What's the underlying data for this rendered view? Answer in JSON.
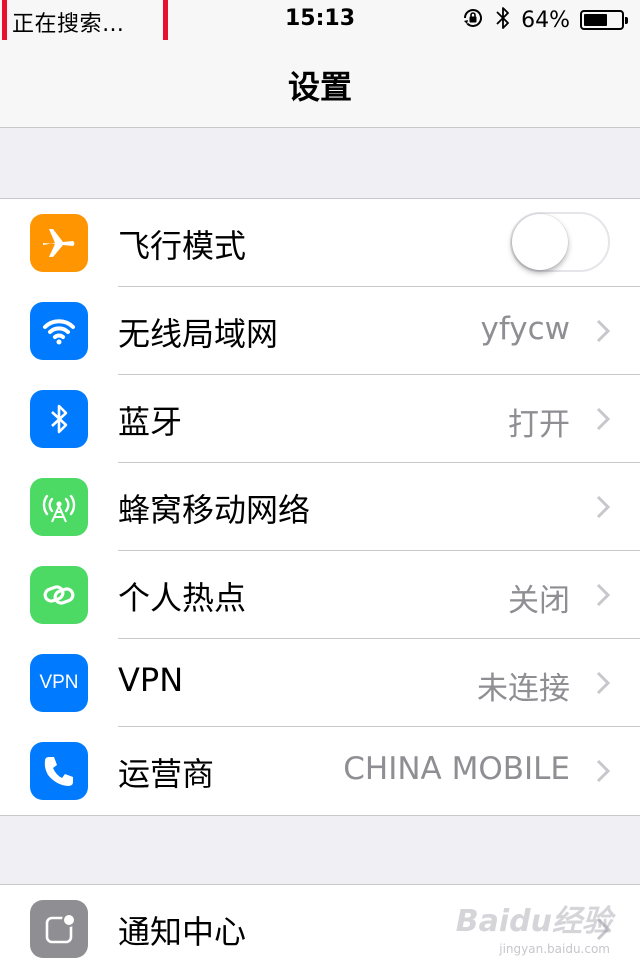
{
  "status_bar": {
    "carrier_text": "正在搜索…",
    "time": "15:13",
    "battery_percent_text": "64%",
    "battery_level": 0.64,
    "icons": [
      "orientation-lock-icon",
      "bluetooth-icon",
      "battery-icon"
    ]
  },
  "nav": {
    "title": "设置"
  },
  "colors": {
    "airplane": "#ff9500",
    "wifi": "#007aff",
    "bluetooth": "#007aff",
    "cellular": "#4cd964",
    "hotspot": "#4cd964",
    "vpn": "#007aff",
    "carrier": "#007aff",
    "notifications": "#8e8e93",
    "highlight_box": "#e8112d"
  },
  "group1": {
    "rows": [
      {
        "label": "飞行模式",
        "icon": "airplane-icon",
        "control": "toggle",
        "toggle_on": false
      },
      {
        "label": "无线局域网",
        "icon": "wifi-icon",
        "value": "yfycw"
      },
      {
        "label": "蓝牙",
        "icon": "bluetooth-icon",
        "value": "打开"
      },
      {
        "label": "蜂窝移动网络",
        "icon": "cellular-icon",
        "value": ""
      },
      {
        "label": "个人热点",
        "icon": "hotspot-icon",
        "value": "关闭"
      },
      {
        "label": "VPN",
        "icon": "vpn-icon",
        "icon_text": "VPN",
        "value": "未连接"
      },
      {
        "label": "运营商",
        "icon": "phone-icon",
        "value": "CHINA MOBILE"
      }
    ]
  },
  "group2": {
    "rows": [
      {
        "label": "通知中心",
        "icon": "notification-center-icon"
      }
    ]
  },
  "watermark": {
    "text": "Baidu经验",
    "sub": "jingyan.baidu.com"
  }
}
